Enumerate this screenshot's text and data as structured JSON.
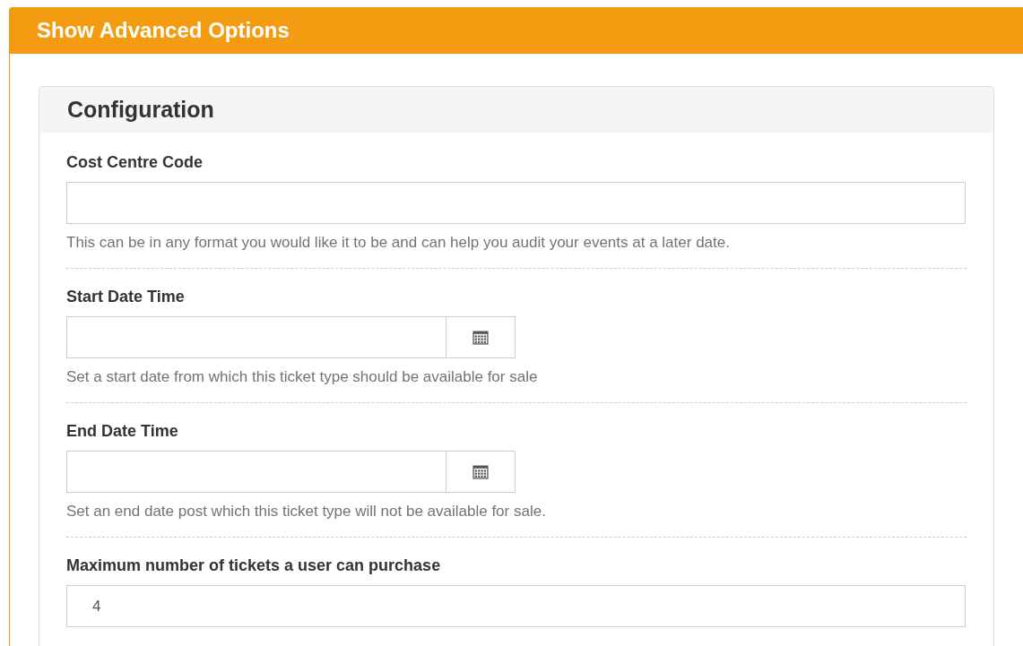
{
  "header": {
    "title": "Show Advanced Options"
  },
  "panel": {
    "title": "Configuration",
    "fields": [
      {
        "kind": "text",
        "label": "Cost Centre Code",
        "help": "This can be in any format you would like it to be and can help you audit your events at a later date."
      },
      {
        "kind": "date",
        "label": "Start Date Time",
        "help": "Set a start date from which this ticket type should be available for sale"
      },
      {
        "kind": "date",
        "label": "End Date Time",
        "help": "Set an end date post which this ticket type will not be available for sale."
      },
      {
        "kind": "text",
        "label": "Maximum number of tickets a user can purchase",
        "value": "4"
      }
    ]
  }
}
